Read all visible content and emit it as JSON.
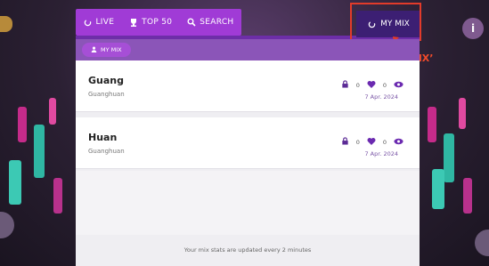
{
  "nav": {
    "live_label": "LIVE",
    "top50_label": "TOP 50",
    "search_label": "SEARCH",
    "mymix_label": "MY MIX"
  },
  "panel": {
    "pill_label": "MY MIX",
    "entries": [
      {
        "title": "Guang",
        "subtitle": "Guanghuan",
        "likes": "0",
        "views": "0",
        "date": "7 Apr. 2024"
      },
      {
        "title": "Huan",
        "subtitle": "Guanghuan",
        "likes": "0",
        "views": "0",
        "date": "7 Apr. 2024"
      }
    ],
    "footer": "Your mix stats are updated every 2 minutes"
  },
  "annotation": {
    "text": "点击 ‘MY MIX’"
  },
  "info_label": "i",
  "colors": {
    "nav_bg": "#a03bd6",
    "mymix_bg": "#3c1f73",
    "annotation": "#e23b2a"
  }
}
